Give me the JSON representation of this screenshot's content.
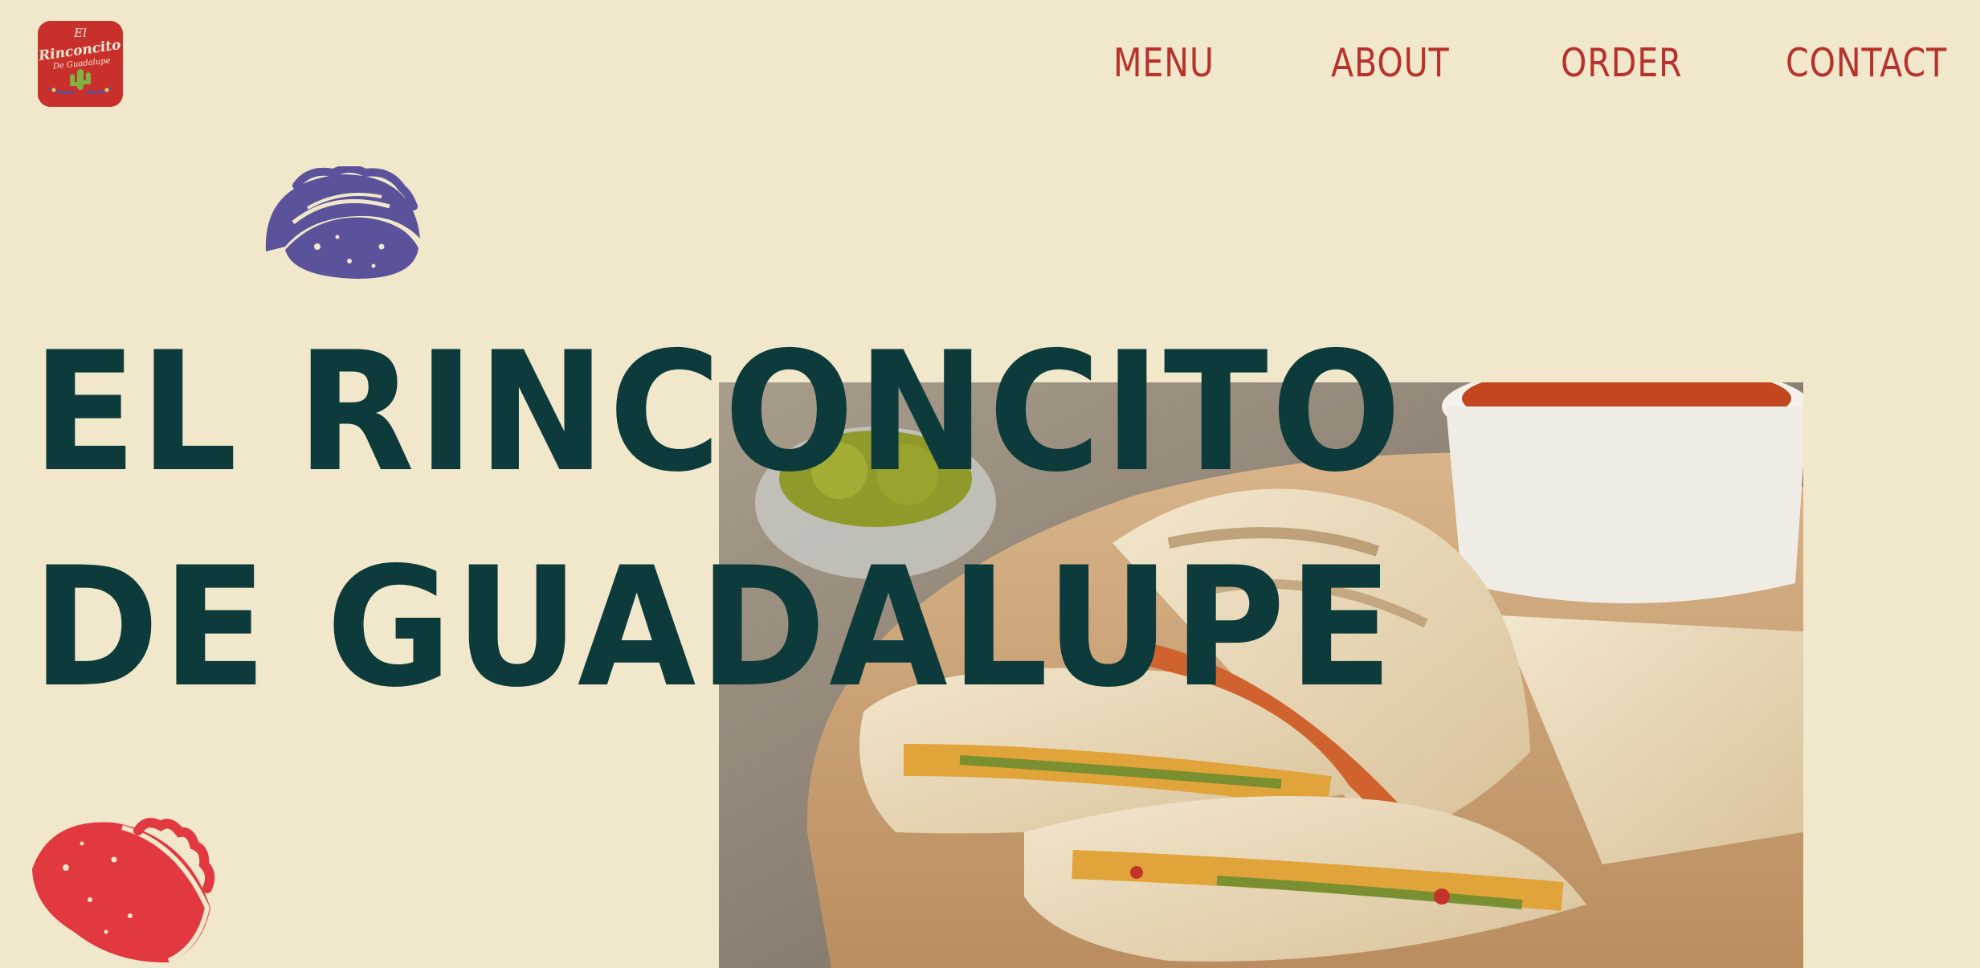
{
  "brand": {
    "logo_line1": "El",
    "logo_line2": "Rinconcito",
    "logo_line3": "De Guadalupe",
    "logo_icon": "cactus-icon",
    "logo_color": "#C9302C"
  },
  "nav": {
    "items": [
      {
        "label": "MENU"
      },
      {
        "label": "ABOUT"
      },
      {
        "label": "ORDER"
      },
      {
        "label": "CONTACT"
      }
    ],
    "color": "#B8322B"
  },
  "hero": {
    "title_line1": "EL RINCONCITO",
    "title_line2": "DE GUADALUPE",
    "title_color": "#0D3B3C",
    "background_color": "#F1E7CA",
    "photo_subject": "quesadillas-photo"
  },
  "decorations": {
    "top_icon": "taco-icon",
    "top_icon_color": "#5A529A",
    "bottom_icon": "taco-icon",
    "bottom_icon_color": "#E2383F"
  }
}
